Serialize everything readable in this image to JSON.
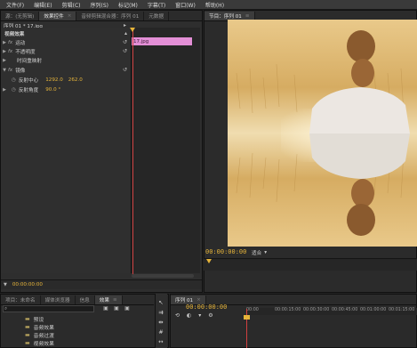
{
  "menu": [
    "文件(F)",
    "编辑(E)",
    "剪辑(C)",
    "序列(S)",
    "标记(M)",
    "字幕(T)",
    "窗口(W)",
    "帮助(H)"
  ],
  "ec_tabs": [
    {
      "label": "源：(无剪辑)",
      "active": false
    },
    {
      "label": "效果控件",
      "active": true
    },
    {
      "label": "音频剪辑混合器：序列 01",
      "active": false
    },
    {
      "label": "元数据",
      "active": false
    }
  ],
  "ec_header": {
    "sequence": "序列 01 * 17.jpg",
    "clip_name": "17.jpg"
  },
  "effects": {
    "section_title": "视频效果",
    "rows": [
      {
        "fx": "fx",
        "label": "运动"
      },
      {
        "fx": "fx",
        "label": "不透明度"
      },
      {
        "fx": "",
        "label": "时间重映射"
      },
      {
        "fx": "fx",
        "label": "镜像"
      }
    ],
    "mirror_params": [
      {
        "label": "反射中心",
        "value1": "1292.0",
        "value2": "262.0"
      },
      {
        "label": "反射角度",
        "value1": "90.0 °",
        "value2": ""
      }
    ]
  },
  "ec_timecode": "00:00:00:00",
  "program": {
    "tab": "节目：序列 01",
    "timecode": "00:00:00:00",
    "fit_label": "适合",
    "fit_chevron": "chevron-down-icon"
  },
  "project": {
    "tabs": [
      {
        "label": "项目：未命名",
        "active": false
      },
      {
        "label": "媒体浏览器",
        "active": false
      },
      {
        "label": "信息",
        "active": false
      },
      {
        "label": "效果",
        "active": true
      }
    ],
    "search_placeholder": "",
    "folders": [
      "预设",
      "音频效果",
      "音频过渡",
      "视频效果",
      "视频过渡"
    ]
  },
  "timeline": {
    "tab": "序列 01",
    "timecode": "00:00:00:00",
    "ruler": [
      "00:00",
      "00:00:15:00",
      "00:00:30:00",
      "00:00:45:00",
      "00:01:00:00",
      "00:01:15:00"
    ]
  },
  "colors": {
    "accent": "#e6b43a",
    "clip": "#e38fd6",
    "playhead": "#d04040"
  }
}
